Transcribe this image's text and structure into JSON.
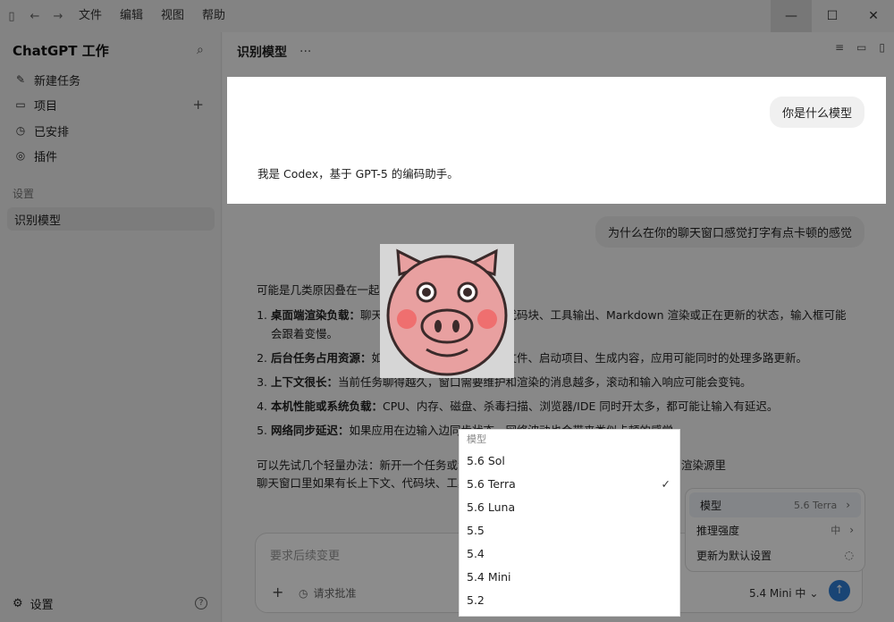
{
  "menu": [
    "文件",
    "编辑",
    "视图",
    "帮助"
  ],
  "sidebar": {
    "title": "ChatGPT 工作",
    "items": [
      {
        "label": "新建任务",
        "icon": "edit-icon"
      },
      {
        "label": "项目",
        "icon": "folder-icon"
      },
      {
        "label": "已安排",
        "icon": "clock-icon"
      },
      {
        "label": "插件",
        "icon": "plugin-icon"
      }
    ],
    "section_label": "设置",
    "selected_item": "识别模型",
    "bottom_label": "设置"
  },
  "main": {
    "title": "识别模型",
    "card": {
      "question": "你是什么模型",
      "answer": "我是 Codex，基于 GPT-5 的编码助手。"
    },
    "question2": "为什么在你的聊天窗口感觉打字有点卡顿的感觉",
    "intro": "可能是几类原因叠在一起：",
    "list": [
      {
        "bold": "桌面端渲染负载：",
        "text": "聊天窗口里如果有长上下文、代码块、工具输出、Markdown 渲染或正在更新的状态，输入框可能会跟着变慢。"
      },
      {
        "bold": "后台任务占用资源：",
        "text": "如果我这边正在跑命令、读文件、启动项目、生成内容，应用可能同时的处理多路更新。"
      },
      {
        "bold": "上下文很长：",
        "text": "当前任务聊得越久，窗口需要维护和渲染的消息越多，滚动和输入响应可能会变钝。"
      },
      {
        "bold": "本机性能或系统负载：",
        "text": "CPU、内存、磁盘、杀毒扫描、浏览器/IDE 同时开太多，都可能让输入有延迟。"
      },
      {
        "bold": "网络同步延迟：",
        "text": "如果应用在边输入边同步状态，网络波动也会带来类似卡顿的感觉。"
      }
    ],
    "tip_line1": "可以先试几个轻量办法：新开一个任务或清理不需要的会话，重启桌面应用，关掉其它渲染源里",
    "tip_line2": "聊天窗口里如果有长上下文、代码块、工具输出较多，尽量开个新任务。"
  },
  "composer": {
    "placeholder": "要求后续变更",
    "permission": "请求批准",
    "model_value": "5.4 Mini 中"
  },
  "submenu": {
    "rows": [
      {
        "label": "模型",
        "value": "5.6 Terra"
      },
      {
        "label": "推理强度",
        "value": "中"
      },
      {
        "label": "更新为默认设置",
        "value": ""
      }
    ]
  },
  "dropdown": {
    "header": "模型",
    "options": [
      "5.6 Sol",
      "5.6 Terra",
      "5.6 Luna",
      "5.5",
      "5.4",
      "5.4 Mini",
      "5.2"
    ],
    "selected": "5.6 Terra"
  },
  "colors": {
    "accent": "#2f7fd6",
    "pig": "#e8a0a0"
  }
}
